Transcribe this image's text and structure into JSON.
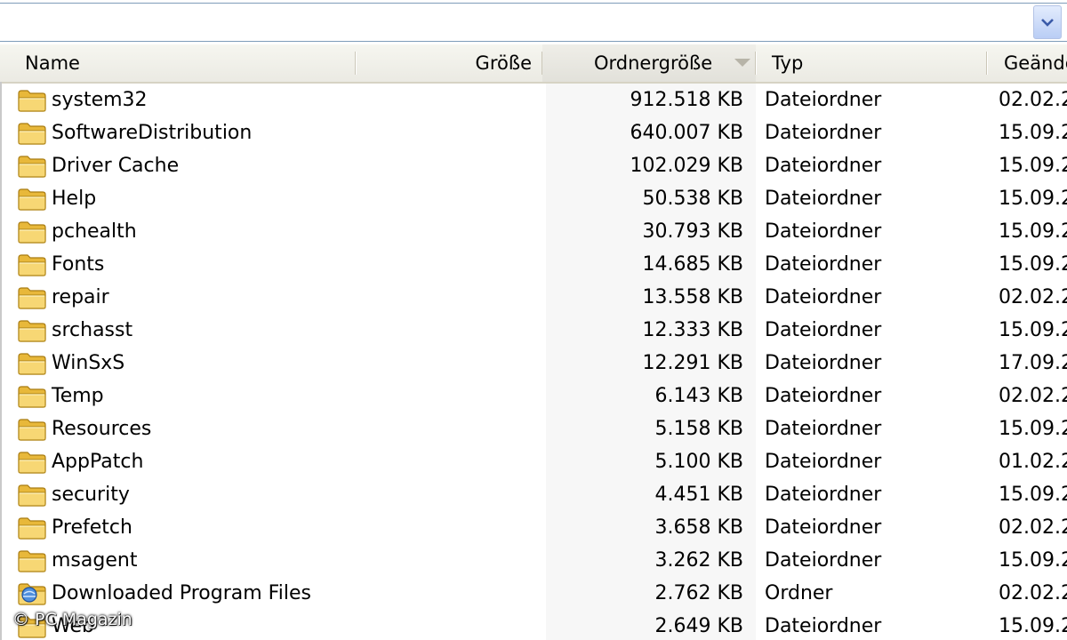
{
  "header": {
    "name": "Name",
    "size": "Größe",
    "folder_size": "Ordnergröße",
    "type": "Typ",
    "modified": "Geände"
  },
  "rows": [
    {
      "name": "system32",
      "folder_size": "912.518 KB",
      "type": "Dateiordner",
      "modified": "02.02.2",
      "icon": "folder-icon"
    },
    {
      "name": "SoftwareDistribution",
      "folder_size": "640.007 KB",
      "type": "Dateiordner",
      "modified": "15.09.2",
      "icon": "folder-icon"
    },
    {
      "name": "Driver Cache",
      "folder_size": "102.029 KB",
      "type": "Dateiordner",
      "modified": "15.09.2",
      "icon": "folder-icon"
    },
    {
      "name": "Help",
      "folder_size": "50.538 KB",
      "type": "Dateiordner",
      "modified": "15.09.2",
      "icon": "folder-icon"
    },
    {
      "name": "pchealth",
      "folder_size": "30.793 KB",
      "type": "Dateiordner",
      "modified": "15.09.2",
      "icon": "folder-icon"
    },
    {
      "name": "Fonts",
      "folder_size": "14.685 KB",
      "type": "Dateiordner",
      "modified": "15.09.2",
      "icon": "folder-icon"
    },
    {
      "name": "repair",
      "folder_size": "13.558 KB",
      "type": "Dateiordner",
      "modified": "02.02.2",
      "icon": "folder-icon"
    },
    {
      "name": "srchasst",
      "folder_size": "12.333 KB",
      "type": "Dateiordner",
      "modified": "15.09.2",
      "icon": "folder-icon"
    },
    {
      "name": "WinSxS",
      "folder_size": "12.291 KB",
      "type": "Dateiordner",
      "modified": "17.09.2",
      "icon": "folder-icon"
    },
    {
      "name": "Temp",
      "folder_size": "6.143 KB",
      "type": "Dateiordner",
      "modified": "02.02.2",
      "icon": "folder-icon"
    },
    {
      "name": "Resources",
      "folder_size": "5.158 KB",
      "type": "Dateiordner",
      "modified": "15.09.2",
      "icon": "folder-icon"
    },
    {
      "name": "AppPatch",
      "folder_size": "5.100 KB",
      "type": "Dateiordner",
      "modified": "01.02.2",
      "icon": "folder-icon"
    },
    {
      "name": "security",
      "folder_size": "4.451 KB",
      "type": "Dateiordner",
      "modified": "15.09.2",
      "icon": "folder-icon"
    },
    {
      "name": "Prefetch",
      "folder_size": "3.658 KB",
      "type": "Dateiordner",
      "modified": "02.02.2",
      "icon": "folder-icon"
    },
    {
      "name": "msagent",
      "folder_size": "3.262 KB",
      "type": "Dateiordner",
      "modified": "15.09.2",
      "icon": "folder-icon"
    },
    {
      "name": "Downloaded Program Files",
      "folder_size": "2.762 KB",
      "type": "Ordner",
      "modified": "02.02.2",
      "icon": "special-folder-icon"
    },
    {
      "name": "Web",
      "folder_size": "2.649 KB",
      "type": "Dateiordner",
      "modified": "15.09.2",
      "icon": "folder-icon"
    }
  ],
  "watermark": "© PC Magazin"
}
